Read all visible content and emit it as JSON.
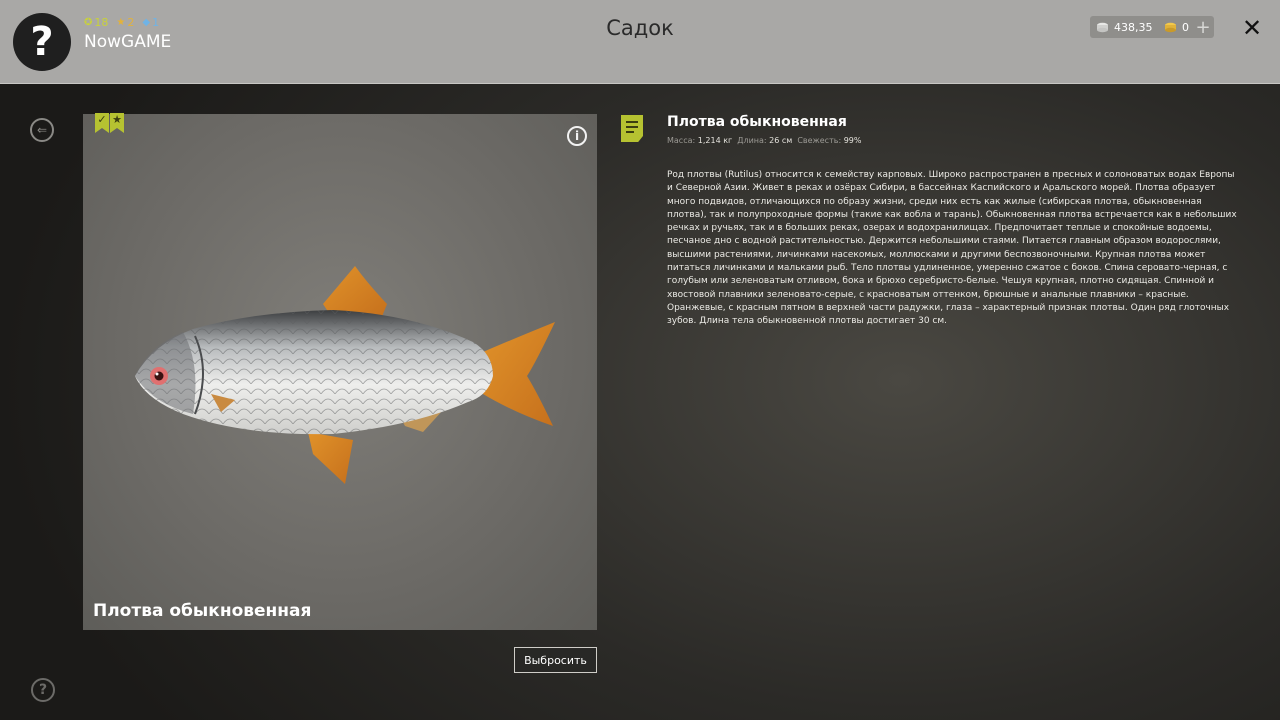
{
  "header": {
    "title": "Садок",
    "username": "NowGAME",
    "stats": {
      "level": "18",
      "rank": "2",
      "premium": "1"
    },
    "silver": "438,35",
    "gold": "0"
  },
  "fish": {
    "name": "Плотва обыкновенная",
    "caption": "Плотва обыкновенная",
    "stats": {
      "mass_label": "Масса:",
      "mass_value": "1,214 кг",
      "length_label": "Длина:",
      "length_value": "26 см",
      "freshness_label": "Свежесть:",
      "freshness_value": "99%"
    },
    "description": "Род плотвы (Rutilus) относится к семейству карповых. Широко распространен в пресных и солоноватых водах Европы и Северной Азии. Живет в реках и озёрах Сибири, в бассейнах Каспийского и Аральского морей. Плотва образует много подвидов, отличающихся по образу жизни, среди них есть как жилые (сибирская плотва, обыкновенная плотва), так и полупроходные формы (такие как вобла и тарань). Обыкновенная плотва встречается как в небольших речках и ручьях, так и в больших реках, озерах и водохранилищах. Предпочитает теплые и спокойные водоемы, песчаное дно с водной растительностью. Держится небольшими стаями. Питается главным образом водорослями, высшими растениями, личинками насекомых, моллюсками и другими беспозвоночными. Крупная плотва может питаться личинками и мальками рыб. Тело плотвы удлиненное, умеренно сжатое с боков. Спина серовато-черная, с голубым или зеленоватым отливом, бока и брюхо серебристо-белые. Чешуя крупная, плотно сидящая. Спинной и хвостовой плавники зеленовато-серые, с красноватым оттенком, брюшные и анальные плавники – красные. Оранжевые, с красным пятном в верхней части радужки, глаза – характерный признак плотвы. Один ряд глоточных зубов. Длина тела обыкновенной плотвы достигает 30 см."
  },
  "actions": {
    "discard": "Выбросить"
  },
  "icons": {
    "avatar": "?",
    "close": "✕",
    "plus": "+",
    "help": "?",
    "info": "i",
    "back": "⇐",
    "badge_check": "✓",
    "badge_star": "★"
  },
  "colors": {
    "accent": "#b6c231",
    "topbar": "#a9a8a6"
  }
}
